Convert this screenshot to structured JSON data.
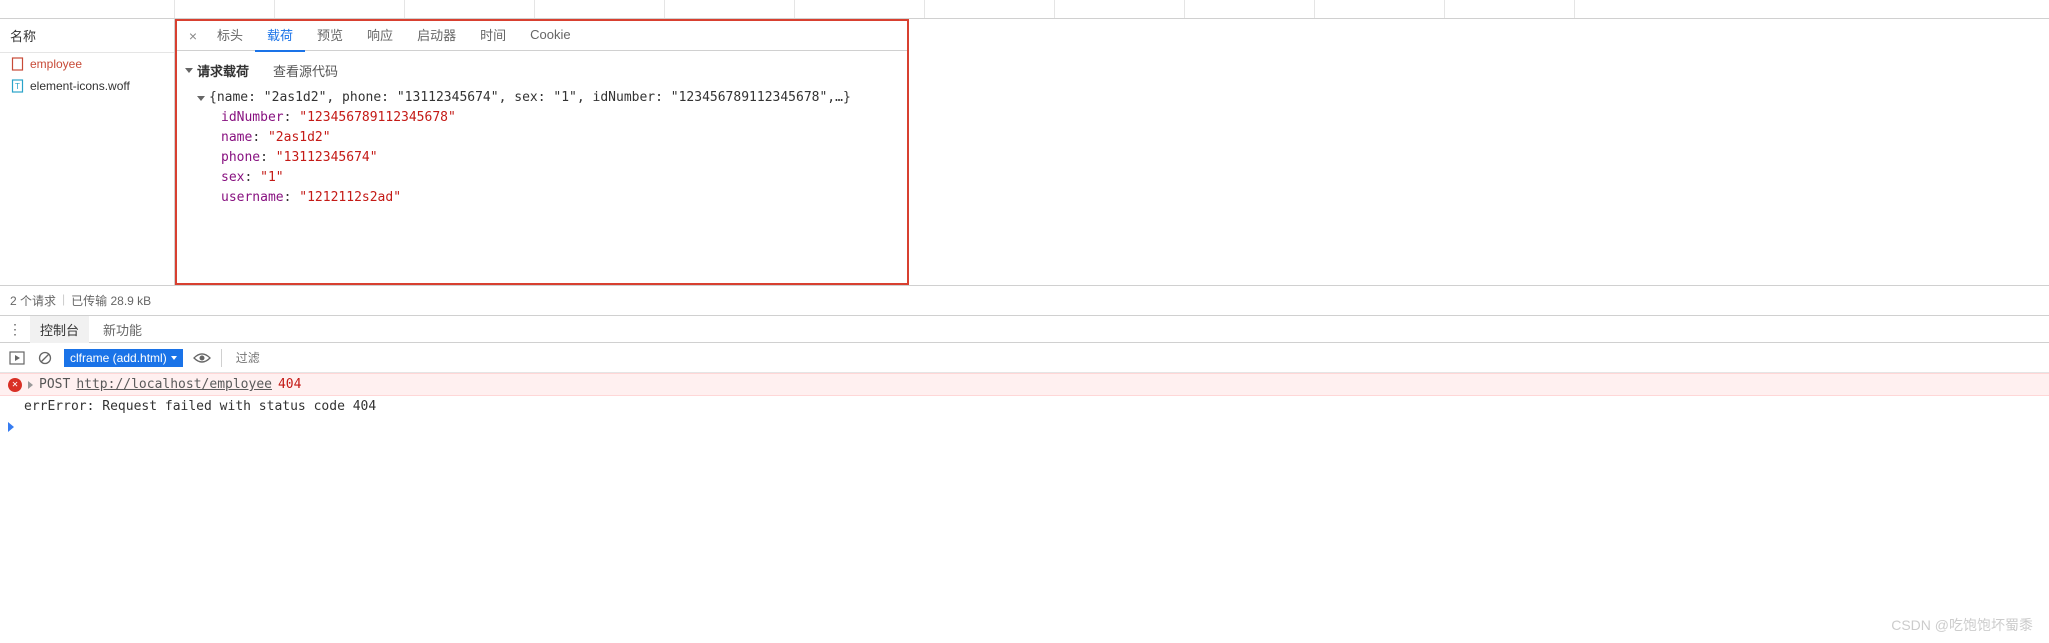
{
  "sidebar": {
    "header": "名称",
    "items": [
      {
        "label": "employee",
        "active": true,
        "icon": "document"
      },
      {
        "label": "element-icons.woff",
        "active": false,
        "icon": "font"
      }
    ]
  },
  "tabs": {
    "close": "×",
    "items": [
      "标头",
      "载荷",
      "预览",
      "响应",
      "启动器",
      "时间",
      "Cookie"
    ],
    "activeIndex": 1
  },
  "payload": {
    "title": "请求载荷",
    "viewSource": "查看源代码",
    "summary": "{name: \"2as1d2\", phone: \"13112345674\", sex: \"1\", idNumber: \"123456789112345678\",…}",
    "rows": [
      {
        "key": "idNumber",
        "value": "\"123456789112345678\""
      },
      {
        "key": "name",
        "value": "\"2as1d2\""
      },
      {
        "key": "phone",
        "value": "\"13112345674\""
      },
      {
        "key": "sex",
        "value": "\"1\""
      },
      {
        "key": "username",
        "value": "\"1212112s2ad\""
      }
    ]
  },
  "statusBar": {
    "requests": "2 个请求",
    "transferred": "已传输 28.9 kB"
  },
  "drawer": {
    "tabs": [
      "控制台",
      "新功能"
    ],
    "activeIndex": 0
  },
  "consoleToolbar": {
    "context": "clframe (add.html)",
    "filterPlaceholder": "过滤"
  },
  "console": {
    "error": {
      "method": "POST",
      "url": "http://localhost/employee",
      "status": "404"
    },
    "message": "errError: Request failed with status code 404"
  },
  "watermark": "CSDN @吃饱饱坏蜀黍"
}
